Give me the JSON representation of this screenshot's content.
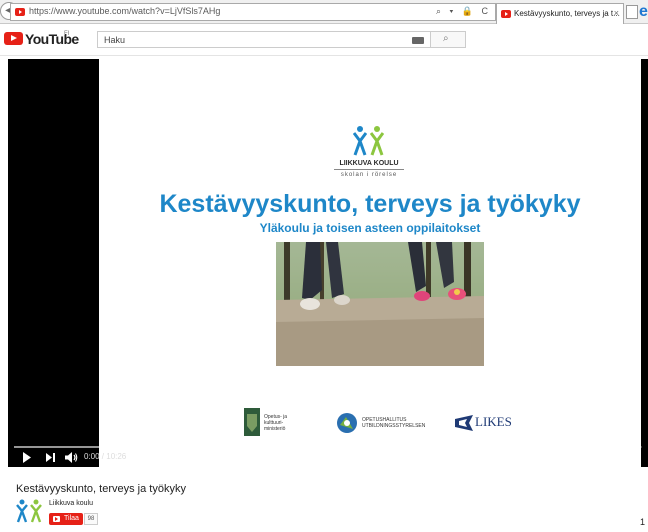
{
  "browser": {
    "url": "https://www.youtube.com/watch?v=LjVfSls7AHg",
    "tab_title": "Kestävyyskunto, terveys ja t...",
    "tab_close": "×",
    "ie_icon": "e",
    "url_actions": "⌕ ▾ 🔒 C"
  },
  "youtube": {
    "logo_text": "YouTube",
    "country_code": "FI",
    "search_placeholder": "Haku"
  },
  "slide": {
    "org_name": "LIIKKUVA KOULU",
    "org_subtitle": "skolan i rörelse",
    "title": "Kestävyyskunto, terveys ja työkyky",
    "subtitle": "Yläkoulu ja toisen asteen oppilaitokset",
    "logo1_text": [
      "Opetus- ja",
      "kulttuuri-",
      "ministeriö"
    ],
    "logo2_text": [
      "OPETUSHALLITUS",
      "UTBILDNINGSSTYRELSEN"
    ],
    "logo3_text": "LIKES"
  },
  "player": {
    "time_text": "0:00 / 10:26",
    "progress": 0
  },
  "video": {
    "title": "Kestävyyskunto, terveys ja työkyky",
    "channel_name": "Liikkuva koulu",
    "subscribe_label": "Tilaa",
    "subscriber_count": "98",
    "view_count": "1"
  },
  "colors": {
    "youtube_red": "#e62117",
    "slide_blue": "#1e87c8",
    "lk_green": "#8cc63f"
  }
}
